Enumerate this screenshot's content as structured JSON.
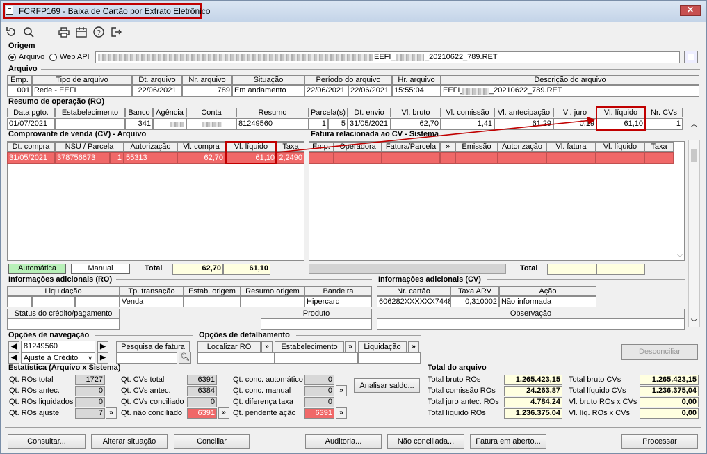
{
  "window": {
    "title": "FCRFP169 - Baixa de Cartão por Extrato Eletrônico",
    "close": "✕"
  },
  "origem": {
    "section": "Origem",
    "arquivo": "Arquivo",
    "webapi": "Web API",
    "path_visible": "EEFI_",
    "path_suffix": "_20210622_789.RET"
  },
  "arquivo": {
    "section": "Arquivo",
    "headers": [
      "Emp.",
      "Tipo de arquivo",
      "Dt. arquivo",
      "Nr. arquivo",
      "Situação",
      "Período do arquivo",
      "Hr. arquivo",
      "Descrição do arquivo"
    ],
    "row": {
      "emp": "001",
      "tipo": "Rede - EEFI",
      "dt": "22/06/2021",
      "nr": "789",
      "situacao": "Em andamento",
      "periodo_ini": "22/06/2021",
      "periodo_fim": "22/06/2021",
      "hr": "15:55:04",
      "desc_a": "EEFI_",
      "desc_b": "_20210622_789.RET"
    }
  },
  "ro": {
    "section": "Resumo de operação (RO)",
    "headers": [
      "Data pgto.",
      "Estabelecimento",
      "Banco",
      "Agência",
      "Conta",
      "Resumo",
      "Parcela(s)",
      "Dt. envio",
      "Vl. bruto",
      "Vl. comissão",
      "Vl. antecipação",
      "Vl. juro",
      "Vl. líquido",
      "Nr. CVs"
    ],
    "row": {
      "data": "01/07/2021",
      "banco": "341",
      "resumo": "81249560",
      "parc_a": "1",
      "parc_b": "5",
      "envio": "31/05/2021",
      "bruto": "62,70",
      "comissao": "1,41",
      "antecip": "61,29",
      "juro": "0,19",
      "liquido": "61,10",
      "cvs": "1"
    }
  },
  "cv": {
    "section": "Comprovante de venda (CV) - Arquivo",
    "headers": [
      "Dt. compra",
      "NSU / Parcela",
      "Autorização",
      "Vl. compra",
      "Vl. líquido",
      "Taxa"
    ],
    "row": {
      "dt": "31/05/2021",
      "nsu": "378756673",
      "parc": "1",
      "aut": "55313",
      "compra": "62,70",
      "liquido": "61,10",
      "taxa": "2,2490"
    },
    "automatica": "Automática",
    "manual": "Manual",
    "total_label": "Total",
    "total_compra": "62,70",
    "total_liquido": "61,10"
  },
  "fatura": {
    "section": "Fatura relacionada ao CV - Sistema",
    "headers": [
      "Emp.",
      "Operadora",
      "Fatura/Parcela",
      "»",
      "Emissão",
      "Autorização",
      "Vl. fatura",
      "Vl. líquido",
      "Taxa"
    ],
    "total_label": "Total"
  },
  "inforo": {
    "section": "Informações adicionais (RO)",
    "headers": [
      "Liquidação",
      "Tp. transação",
      "Estab. origem",
      "Resumo origem",
      "Bandeira"
    ],
    "tp": "Venda",
    "bandeira": "Hipercard",
    "status_label": "Status do crédito/pagamento",
    "produto_label": "Produto"
  },
  "infocv": {
    "section": "Informações adicionais (CV)",
    "headers": [
      "Nr. cartão",
      "Taxa ARV",
      "Ação"
    ],
    "cartao": "606282XXXXXX7448",
    "taxa": "0,310002",
    "acao": "Não informada",
    "obs_label": "Observação"
  },
  "nav": {
    "section": "Opções de navegação",
    "value": "81249560",
    "select": "Ajuste à Crédito",
    "pesquisa": "Pesquisa de fatura"
  },
  "det": {
    "section": "Opções de detalhamento",
    "localizar": "Localizar RO",
    "estab": "Estabelecimento",
    "liquidacao": "Liquidação"
  },
  "desconciliar": "Desconciliar",
  "stats": {
    "section": "Estatística (Arquivo x Sistema)",
    "col1": [
      {
        "l": "Qt. ROs total",
        "v": "1727"
      },
      {
        "l": "Qt. ROs antec.",
        "v": "0"
      },
      {
        "l": "Qt. ROs liquidados",
        "v": "0"
      },
      {
        "l": "Qt. ROs ajuste",
        "v": "7"
      }
    ],
    "col2": [
      {
        "l": "Qt. CVs total",
        "v": "6391"
      },
      {
        "l": "Qt. CVs antec.",
        "v": "6384"
      },
      {
        "l": "Qt. CVs conciliado",
        "v": "0"
      },
      {
        "l": "Qt. não conciliado",
        "v": "6391"
      }
    ],
    "col3": [
      {
        "l": "Qt. conc. automático",
        "v": "0"
      },
      {
        "l": "Qt. conc. manual",
        "v": "0"
      },
      {
        "l": "Qt. diferença taxa",
        "v": "0"
      },
      {
        "l": "Qt. pendente ação",
        "v": "6391"
      }
    ],
    "analisar": "Analisar saldo..."
  },
  "totais": {
    "section": "Total do arquivo",
    "left": [
      {
        "l": "Total bruto ROs",
        "v": "1.265.423,15"
      },
      {
        "l": "Total comissão ROs",
        "v": "24.263,87"
      },
      {
        "l": "Total juro antec. ROs",
        "v": "4.784,24"
      },
      {
        "l": "Total líquido ROs",
        "v": "1.236.375,04"
      }
    ],
    "right": [
      {
        "l": "Total bruto CVs",
        "v": "1.265.423,15"
      },
      {
        "l": "Total líquido CVs",
        "v": "1.236.375,04"
      },
      {
        "l": "Vl. bruto ROs x CVs",
        "v": "0,00"
      },
      {
        "l": "Vl. líq. ROs x CVs",
        "v": "0,00"
      }
    ]
  },
  "buttons": {
    "consultar": "Consultar...",
    "alterar": "Alterar situação",
    "conciliar": "Conciliar",
    "auditoria": "Auditoria...",
    "nao_conc": "Não conciliada...",
    "fatura": "Fatura em aberto...",
    "processar": "Processar"
  },
  "colors": {
    "highlight": "#c00000",
    "selected_row": "#f06868",
    "total_bg": "#ffffe0"
  }
}
